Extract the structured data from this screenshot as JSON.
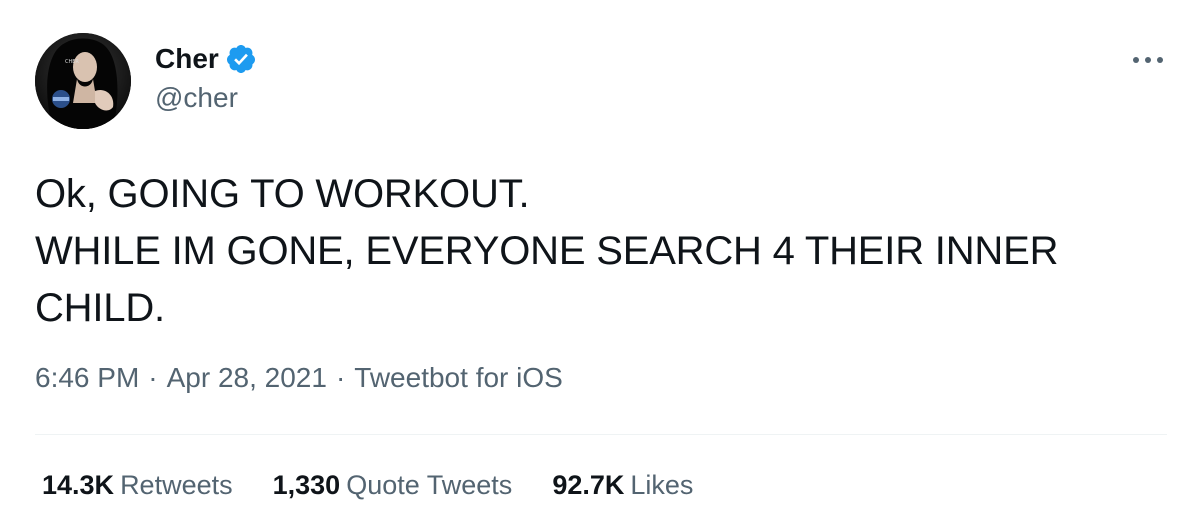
{
  "author": {
    "display_name": "Cher",
    "handle": "@cher",
    "verified": true,
    "avatar_icon": "profile-photo"
  },
  "menu": {
    "icon": "more-horizontal-icon"
  },
  "tweet": {
    "text": "Ok, GOING TO WORKOUT.\nWHILE IM GONE, EVERYONE SEARCH 4 THEIR INNER CHILD.",
    "time": "6:46 PM",
    "date": "Apr 28, 2021",
    "source": "Tweetbot for iOS",
    "separator": "·"
  },
  "stats": {
    "retweets_count": "14.3K",
    "retweets_label": "Retweets",
    "quotes_count": "1,330",
    "quotes_label": "Quote Tweets",
    "likes_count": "92.7K",
    "likes_label": "Likes"
  },
  "colors": {
    "verified_blue": "#1d9bf0",
    "primary_text": "#0f1419",
    "secondary_text": "#536471",
    "divider": "#eff3f4"
  }
}
